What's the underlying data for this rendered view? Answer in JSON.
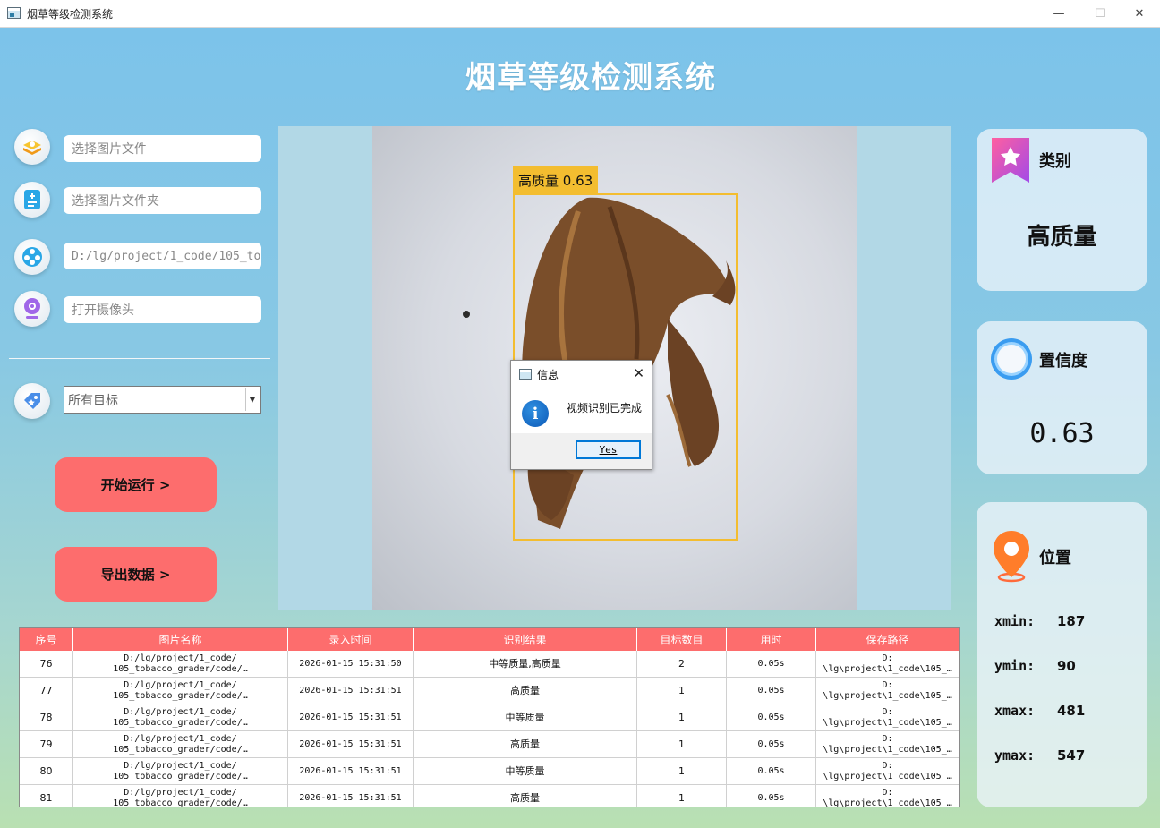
{
  "window": {
    "title": "烟草等级检测系统",
    "minimize": "—",
    "maximize": "☐",
    "close": "✕"
  },
  "app_title": "烟草等级检测系统",
  "sidebar": {
    "image_file_placeholder": "选择图片文件",
    "image_folder_placeholder": "选择图片文件夹",
    "video_path_value": "D:/lg/project/1_code/105_to",
    "camera_placeholder": "打开摄像头",
    "target_select_value": "所有目标",
    "run_button": "开始运行 >",
    "export_button": "导出数据 >"
  },
  "detection": {
    "label": "高质量 0.63"
  },
  "dialog": {
    "title": "信息",
    "message": "视频识别已完成",
    "ok_button": "Yes",
    "info_glyph": "i"
  },
  "result_cards": {
    "class": {
      "label": "类别",
      "value": "高质量"
    },
    "confidence": {
      "label": "置信度",
      "value": "0.63"
    },
    "position": {
      "label": "位置",
      "xmin_label": "xmin:",
      "xmin": "187",
      "ymin_label": "ymin:",
      "ymin": "90",
      "xmax_label": "xmax:",
      "xmax": "481",
      "ymax_label": "ymax:",
      "ymax": "547"
    }
  },
  "table": {
    "headers": [
      "序号",
      "图片名称",
      "录入时间",
      "识别结果",
      "目标数目",
      "用时",
      "保存路径"
    ],
    "rows": [
      {
        "id": "76",
        "name": "D:/lg/project/1_code/\n105_tobacco_grader/code/…",
        "time": "2026-01-15 15:31:50",
        "result": "中等质量,高质量",
        "count": "2",
        "duration": "0.05s",
        "path": "D:\n\\lg\\project\\1_code\\105_…"
      },
      {
        "id": "77",
        "name": "D:/lg/project/1_code/\n105_tobacco_grader/code/…",
        "time": "2026-01-15 15:31:51",
        "result": "高质量",
        "count": "1",
        "duration": "0.05s",
        "path": "D:\n\\lg\\project\\1_code\\105_…"
      },
      {
        "id": "78",
        "name": "D:/lg/project/1_code/\n105_tobacco_grader/code/…",
        "time": "2026-01-15 15:31:51",
        "result": "中等质量",
        "count": "1",
        "duration": "0.05s",
        "path": "D:\n\\lg\\project\\1_code\\105_…"
      },
      {
        "id": "79",
        "name": "D:/lg/project/1_code/\n105_tobacco_grader/code/…",
        "time": "2026-01-15 15:31:51",
        "result": "高质量",
        "count": "1",
        "duration": "0.05s",
        "path": "D:\n\\lg\\project\\1_code\\105_…"
      },
      {
        "id": "80",
        "name": "D:/lg/project/1_code/\n105_tobacco_grader/code/…",
        "time": "2026-01-15 15:31:51",
        "result": "中等质量",
        "count": "1",
        "duration": "0.05s",
        "path": "D:\n\\lg\\project\\1_code\\105_…"
      },
      {
        "id": "81",
        "name": "D:/lg/project/1_code/\n105_tobacco_grader/code/…",
        "time": "2026-01-15 15:31:51",
        "result": "高质量",
        "count": "1",
        "duration": "0.05s",
        "path": "D:\n\\lg\\project\\1_code\\105_…"
      }
    ]
  },
  "colors": {
    "accent": "#fd6d6d",
    "bbox": "#f3bd30",
    "dialog_button": "#0078d7"
  },
  "icons": {
    "image_file": "image-file-icon",
    "image_folder": "image-folder-icon",
    "video": "video-reel-icon",
    "camera": "webcam-icon",
    "target": "tag-icon",
    "class": "bookmark-star-icon",
    "confidence": "ring-icon",
    "position": "location-pin-icon"
  }
}
